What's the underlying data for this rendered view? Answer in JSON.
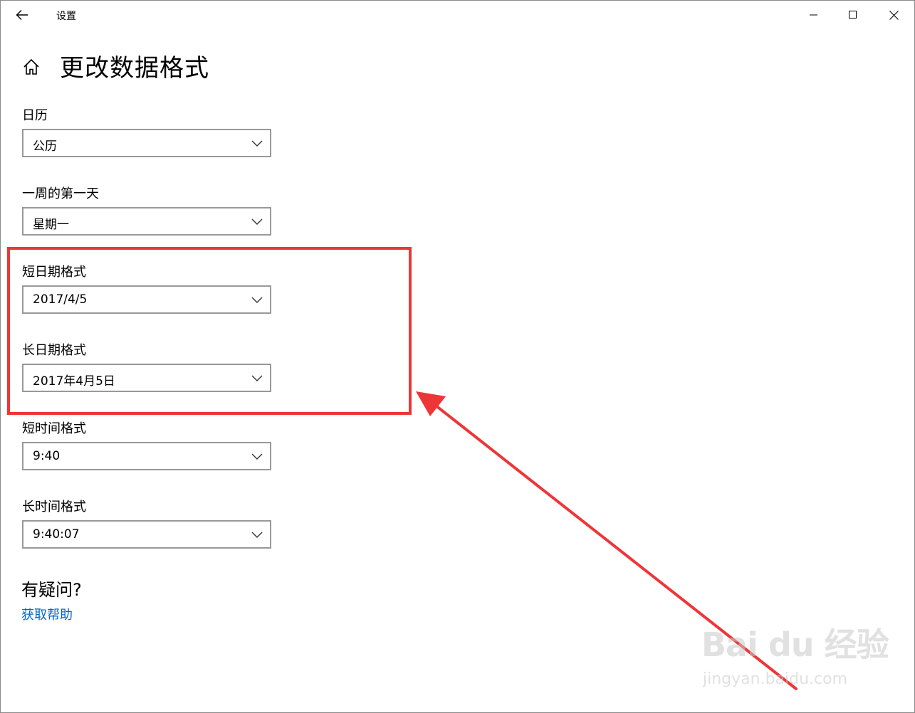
{
  "titlebar": {
    "app_title": "设置",
    "back_icon": "back-arrow-icon",
    "minimize_icon": "minimize-icon",
    "maximize_icon": "maximize-icon",
    "close_icon": "close-icon"
  },
  "page": {
    "home_icon": "home-icon",
    "title": "更改数据格式"
  },
  "fields": [
    {
      "label": "日历",
      "value": "公历"
    },
    {
      "label": "一周的第一天",
      "value": "星期一"
    },
    {
      "label": "短日期格式",
      "value": "2017/4/5"
    },
    {
      "label": "长日期格式",
      "value": "2017年4月5日"
    },
    {
      "label": "短时间格式",
      "value": "9:40"
    },
    {
      "label": "长时间格式",
      "value": "9:40:07"
    }
  ],
  "help": {
    "heading": "有疑问?",
    "link": "获取帮助"
  },
  "annotation": {
    "color": "#ee3538",
    "highlighted_fields": [
      "短日期格式",
      "长日期格式"
    ]
  },
  "watermark": {
    "brand": "Bai du 经验",
    "url": "jingyan.baidu.com"
  },
  "colors": {
    "link": "#0068c9",
    "combo_border": "#999999",
    "annotation": "#ee3538"
  }
}
